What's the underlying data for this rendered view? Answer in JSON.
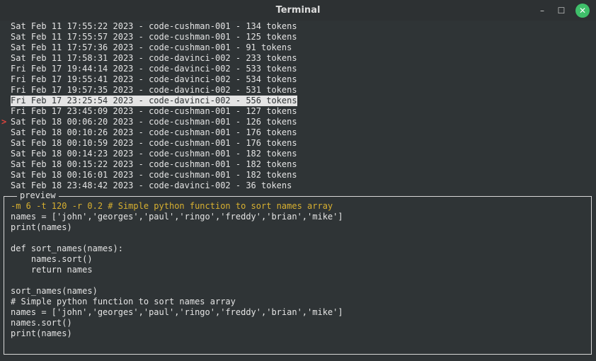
{
  "window": {
    "title": "Terminal",
    "minimize_glyph": "–",
    "maximize_glyph": "☐",
    "close_glyph": "✕"
  },
  "list": {
    "selected_index": 7,
    "marker": ">",
    "rows": [
      "Sat Feb 11 17:55:22 2023 - code-cushman-001 - 134 tokens",
      "Sat Feb 11 17:55:57 2023 - code-cushman-001 - 125 tokens",
      "Sat Feb 11 17:57:36 2023 - code-cushman-001 - 91 tokens",
      "Sat Feb 11 17:58:31 2023 - code-davinci-002 - 233 tokens",
      "Fri Feb 17 19:44:14 2023 - code-davinci-002 - 533 tokens",
      "Fri Feb 17 19:55:41 2023 - code-davinci-002 - 534 tokens",
      "Fri Feb 17 19:57:35 2023 - code-davinci-002 - 531 tokens",
      "Fri Feb 17 23:25:54 2023 - code-davinci-002 - 556 tokens",
      "Fri Feb 17 23:45:09 2023 - code-cushman-001 - 127 tokens",
      "Sat Feb 18 00:06:20 2023 - code-cushman-001 - 126 tokens",
      "Sat Feb 18 00:10:26 2023 - code-cushman-001 - 176 tokens",
      "Sat Feb 18 00:10:59 2023 - code-cushman-001 - 176 tokens",
      "Sat Feb 18 00:14:23 2023 - code-cushman-001 - 182 tokens",
      "Sat Feb 18 00:15:22 2023 - code-cushman-001 - 182 tokens",
      "Sat Feb 18 00:16:01 2023 - code-cushman-001 - 182 tokens",
      "Sat Feb 18 23:48:42 2023 - code-davinci-002 - 36 tokens"
    ]
  },
  "preview": {
    "title": "preview",
    "command": "-m 6 -t 120 -r 0.2 # Simple python function to sort names array",
    "lines": [
      "names = ['john','georges','paul','ringo','freddy','brian','mike']",
      "print(names)",
      "",
      "def sort_names(names):",
      "    names.sort()",
      "    return names",
      "",
      "sort_names(names)",
      "# Simple python function to sort names array",
      "names = ['john','georges','paul','ringo','freddy','brian','mike']",
      "names.sort()",
      "print(names)"
    ]
  },
  "colors": {
    "background": "#2f3436",
    "foreground": "#e4e4e4",
    "command": "#d8b030",
    "marker": "#e0443e",
    "close_button": "#3fbf6a"
  }
}
